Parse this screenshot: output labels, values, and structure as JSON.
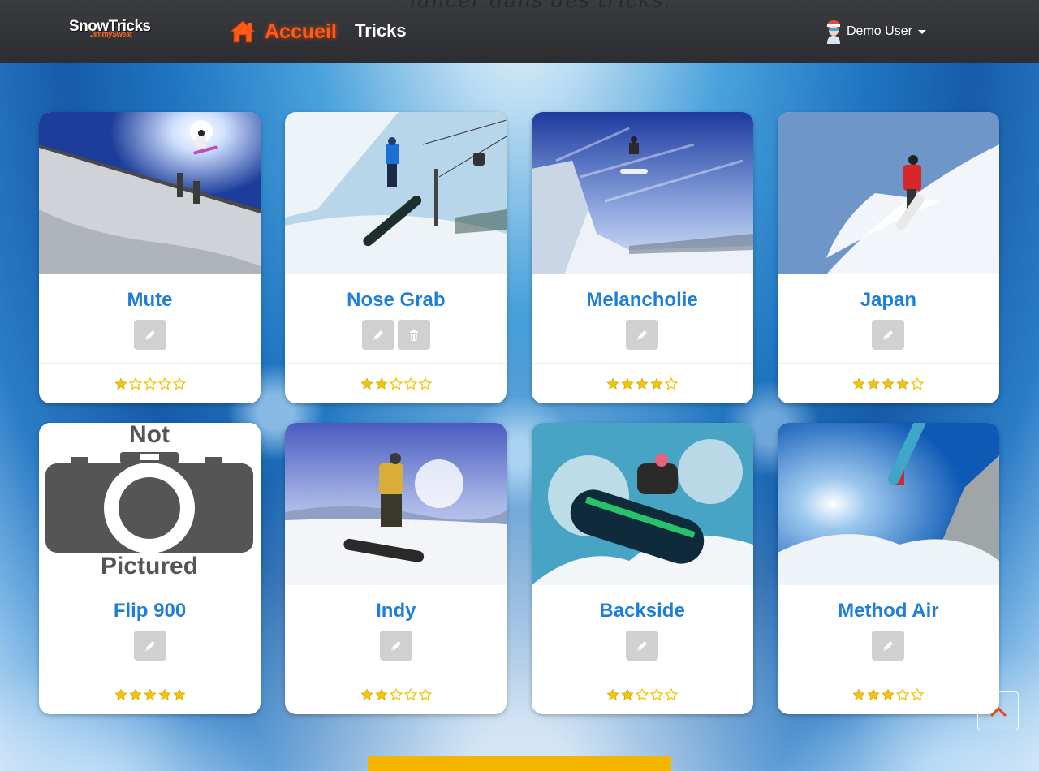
{
  "navbar": {
    "ghost_text": "lancer dans des tricks.",
    "brand_main": "SnowTricks",
    "brand_sub": "JimmySweat",
    "home_label": "Accueil",
    "tricks_label": "Tricks",
    "user_label": "Demo User"
  },
  "colors": {
    "accent": "#ff5a1a",
    "title_blue": "#1f7fd8",
    "star": "#f2c40a",
    "button_gray": "#d0d0d0",
    "more_button": "#f5b400"
  },
  "cards": [
    {
      "title": "Mute",
      "rating": 1,
      "editable": true,
      "deletable": false,
      "image": "snowboarder-jump-roof"
    },
    {
      "title": "Nose Grab",
      "rating": 2,
      "editable": true,
      "deletable": true,
      "image": "snowboarder-powder-lift"
    },
    {
      "title": "Melancholie",
      "rating": 4,
      "editable": true,
      "deletable": false,
      "image": "snowboarder-air-cliff"
    },
    {
      "title": "Japan",
      "rating": 4,
      "editable": true,
      "deletable": false,
      "image": "snowboarder-red-jacket"
    },
    {
      "title": "Flip 900",
      "rating": 5,
      "editable": true,
      "deletable": false,
      "image": "not-pictured",
      "placeholder_top": "Not",
      "placeholder_bottom": "Pictured"
    },
    {
      "title": "Indy",
      "rating": 2,
      "editable": true,
      "deletable": false,
      "image": "snowboarder-yellow-jacket"
    },
    {
      "title": "Backside",
      "rating": 2,
      "editable": true,
      "deletable": false,
      "image": "snowboard-closeup-sky"
    },
    {
      "title": "Method Air",
      "rating": 3,
      "editable": true,
      "deletable": false,
      "image": "snowboarder-high-air-sun"
    }
  ],
  "icons": {
    "home": "home-icon",
    "edit": "pencil-icon",
    "delete": "trash-icon",
    "star_full": "star-full-icon",
    "star_empty": "star-empty-icon",
    "scroll_top": "chevron-up-icon"
  }
}
